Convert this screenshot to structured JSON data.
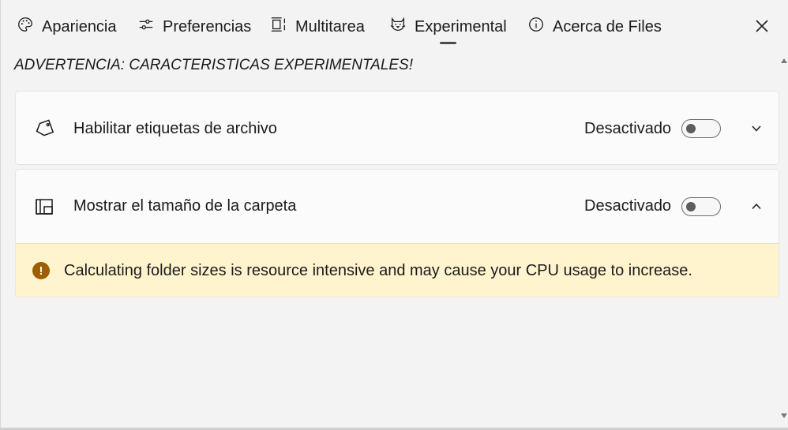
{
  "tabs": [
    {
      "label": "Apariencia",
      "icon": "palette-icon"
    },
    {
      "label": "Preferencias",
      "icon": "sliders-icon"
    },
    {
      "label": "Multitarea",
      "icon": "multitask-icon"
    },
    {
      "label": "Experimental",
      "icon": "cat-icon",
      "selected": true
    },
    {
      "label": "Acerca de Files",
      "icon": "info-icon"
    }
  ],
  "close_icon": "close-icon",
  "warning_heading": "ADVERTENCIA: CARACTERISTICAS EXPERIMENTALES!",
  "settings": [
    {
      "label": "Habilitar etiquetas de archivo",
      "icon": "tag-icon",
      "state_text": "Desactivado",
      "toggle_on": false,
      "expanded": false
    },
    {
      "label": "Mostrar el tamaño de la carpeta",
      "icon": "folder-size-icon",
      "state_text": "Desactivado",
      "toggle_on": false,
      "expanded": true,
      "info_message": "Calculating folder sizes is resource intensive and may cause your CPU usage to increase.",
      "info_icon": "warning-icon"
    }
  ],
  "colors": {
    "background": "#f3f3f3",
    "card": "#fbfbfb",
    "info_bar": "#fff4ce",
    "info_icon": "#9d5d00"
  }
}
